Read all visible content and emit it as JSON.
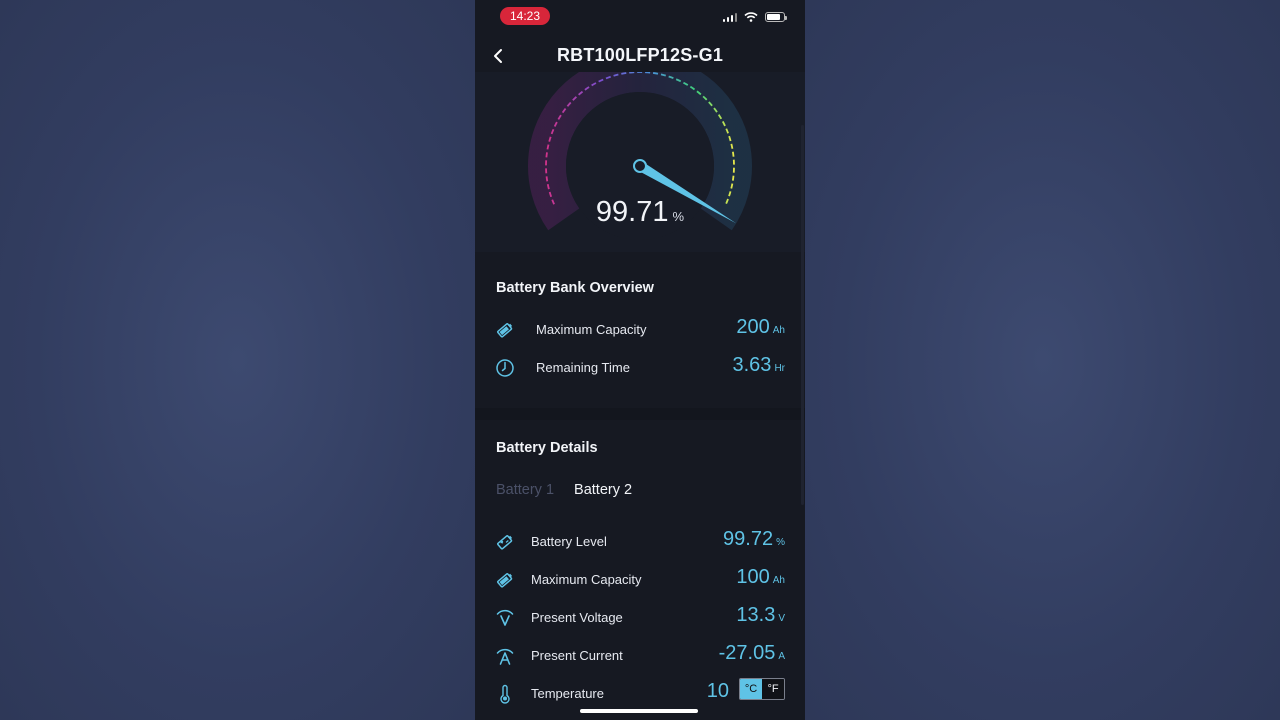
{
  "status": {
    "time": "14:23"
  },
  "header": {
    "title": "RBT100LFP12S-G1"
  },
  "gauge": {
    "value": "99.71",
    "unit": "%",
    "level": 99.71
  },
  "overview": {
    "title": "Battery Bank Overview",
    "rows": [
      {
        "icon": "battery-tilted-icon",
        "label": "Maximum Capacity",
        "value": "200",
        "unit": "Ah"
      },
      {
        "icon": "clock-icon",
        "label": "Remaining Time",
        "value": "3.63",
        "unit": "Hr"
      }
    ]
  },
  "details": {
    "title": "Battery Details",
    "tabs": [
      "Battery 1",
      "Battery 2"
    ],
    "rows": [
      {
        "icon": "battery-level-icon",
        "label": "Battery Level",
        "value": "99.72",
        "unit": "%"
      },
      {
        "icon": "battery-tilted-icon",
        "label": "Maximum Capacity",
        "value": "100",
        "unit": "Ah"
      },
      {
        "icon": "voltage-icon",
        "label": "Present Voltage",
        "value": "13.3",
        "unit": "V"
      },
      {
        "icon": "current-icon",
        "label": "Present Current",
        "value": "-27.05",
        "unit": "A"
      },
      {
        "icon": "thermometer-icon",
        "label": "Temperature",
        "value": "10",
        "unit_c": "°C",
        "unit_f": "°F"
      }
    ]
  },
  "colors": {
    "accent": "#5fc3e6",
    "background": "#161922",
    "status_pill": "#d8263a"
  }
}
